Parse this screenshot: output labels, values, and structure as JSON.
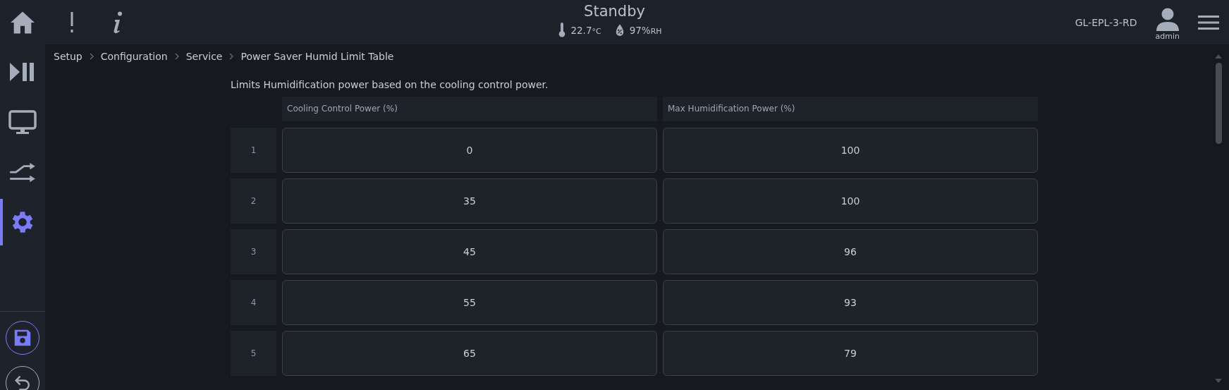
{
  "header": {
    "title": "Standby",
    "temperature": {
      "value": "22.7",
      "unit": "°C"
    },
    "humidity": {
      "value": "97%",
      "unit": "RH"
    },
    "device": "GL-EPL-3-RD",
    "user": "admin"
  },
  "nav": [
    {
      "kind": "playpause",
      "selected": false
    },
    {
      "kind": "monitor",
      "selected": false
    },
    {
      "kind": "arrows",
      "selected": false
    },
    {
      "kind": "gear",
      "selected": true
    }
  ],
  "breadcrumb": [
    "Setup",
    "Configuration",
    "Service",
    "Power Saver Humid Limit Table"
  ],
  "description": "Limits Humidification power based on the cooling control power.",
  "table": {
    "columns": [
      "Cooling Control Power (%)",
      "Max Humidification Power (%)"
    ],
    "rows": [
      {
        "index": "1",
        "cells": [
          "0",
          "100"
        ]
      },
      {
        "index": "2",
        "cells": [
          "35",
          "100"
        ]
      },
      {
        "index": "3",
        "cells": [
          "45",
          "96"
        ]
      },
      {
        "index": "4",
        "cells": [
          "55",
          "93"
        ]
      },
      {
        "index": "5",
        "cells": [
          "65",
          "79"
        ]
      }
    ]
  }
}
